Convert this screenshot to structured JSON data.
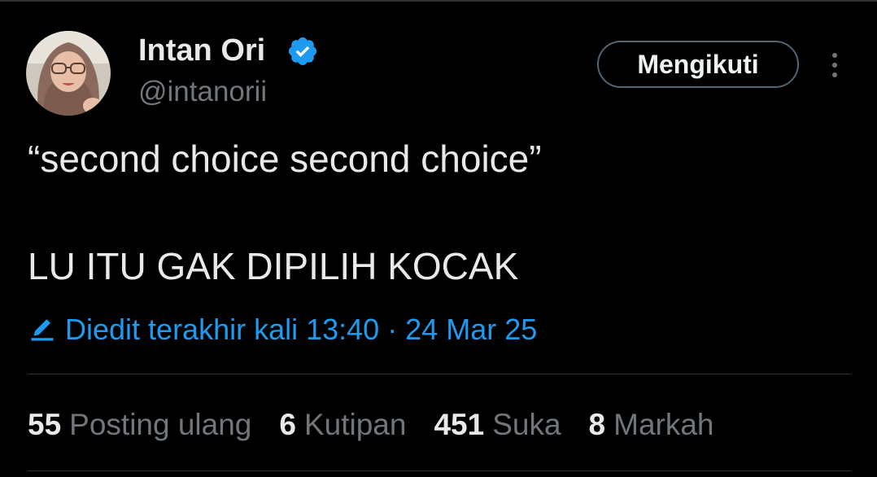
{
  "author": {
    "display_name": "Intan Ori",
    "handle": "@intanorii",
    "verified_icon": "verified-badge-icon",
    "verified_color": "#1d9bf0"
  },
  "header": {
    "follow_label": "Mengikuti",
    "more_icon": "more-vertical-icon"
  },
  "tweet": {
    "lines": [
      "“second choice second choice”",
      "LU ITU GAK DIPILIH KOCAK"
    ]
  },
  "edit_info": {
    "icon": "pencil-icon",
    "text": "Diedit terakhir kali 13:40 · 24 Mar 25",
    "color": "#1d9bf0"
  },
  "stats": [
    {
      "count": "55",
      "label": "Posting ulang"
    },
    {
      "count": "6",
      "label": "Kutipan"
    },
    {
      "count": "451",
      "label": "Suka"
    },
    {
      "count": "8",
      "label": "Markah"
    }
  ],
  "colors": {
    "background": "#000000",
    "text_primary": "#e7e9ea",
    "text_secondary": "#71767b",
    "accent": "#1d9bf0",
    "divider": "#2f3336"
  }
}
